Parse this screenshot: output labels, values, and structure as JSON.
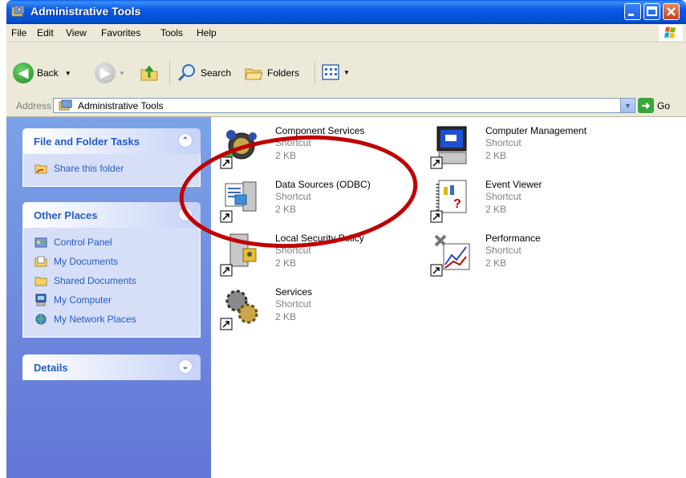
{
  "window": {
    "title": "Administrative Tools"
  },
  "menu": [
    "File",
    "Edit",
    "View",
    "Favorites",
    "Tools",
    "Help"
  ],
  "toolbar": {
    "back_label": "Back",
    "search_label": "Search",
    "folders_label": "Folders"
  },
  "address": {
    "label": "Address",
    "value": "Administrative Tools",
    "go_label": "Go"
  },
  "tasks": {
    "file_folder": {
      "title": "File and Folder Tasks",
      "items": [
        "Share this folder"
      ]
    },
    "other_places": {
      "title": "Other Places",
      "items": [
        "Control Panel",
        "My Documents",
        "Shared Documents",
        "My Computer",
        "My Network Places"
      ]
    },
    "details": {
      "title": "Details"
    }
  },
  "files": [
    {
      "name": "Component Services",
      "type": "Shortcut",
      "size": "2 KB",
      "icon": "component-services-icon"
    },
    {
      "name": "Computer Management",
      "type": "Shortcut",
      "size": "2 KB",
      "icon": "computer-management-icon"
    },
    {
      "name": "Data Sources (ODBC)",
      "type": "Shortcut",
      "size": "2 KB",
      "icon": "data-sources-icon"
    },
    {
      "name": "Event Viewer",
      "type": "Shortcut",
      "size": "2 KB",
      "icon": "event-viewer-icon"
    },
    {
      "name": "Local Security Policy",
      "type": "Shortcut",
      "size": "2 KB",
      "icon": "local-security-policy-icon"
    },
    {
      "name": "Performance",
      "type": "Shortcut",
      "size": "2 KB",
      "icon": "performance-icon"
    },
    {
      "name": "Services",
      "type": "Shortcut",
      "size": "2 KB",
      "icon": "services-icon"
    }
  ],
  "colors": {
    "titlebar": "#0450d2",
    "taskpane": "#7ba2e7",
    "link": "#215dc6",
    "annotation": "#c00000"
  }
}
